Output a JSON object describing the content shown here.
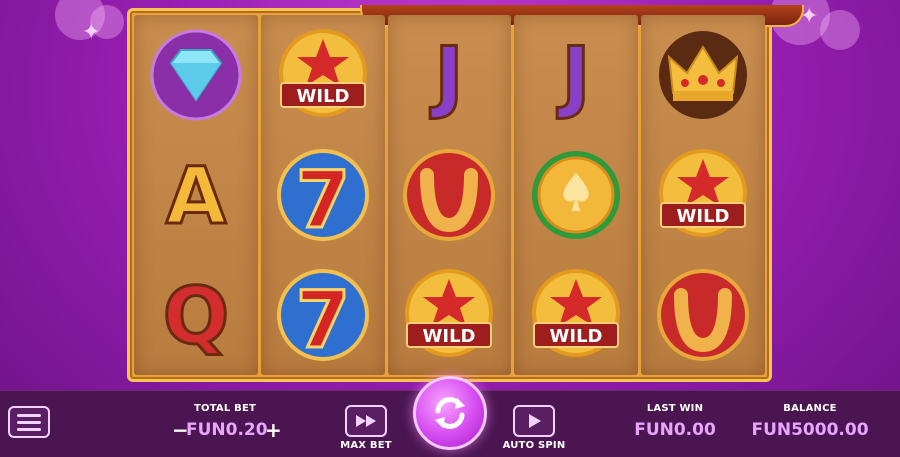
{
  "reels": [
    [
      "diamond",
      "letter-a",
      "letter-q"
    ],
    [
      "wild",
      "seven",
      "seven"
    ],
    [
      "letter-j",
      "horseshoe",
      "wild"
    ],
    [
      "letter-j",
      "spade-coin",
      "wild"
    ],
    [
      "crown",
      "wild",
      "horseshoe"
    ]
  ],
  "wild_label": "WILD",
  "letters": {
    "a": "A",
    "q": "Q",
    "j": "J",
    "seven": "7"
  },
  "bottom_bar": {
    "total_bet_label": "TOTAL BET",
    "total_bet_value": "FUN0.20",
    "minus": "−",
    "plus": "+",
    "max_bet_label": "MAX BET",
    "auto_spin_label": "AUTO SPIN",
    "last_win_label": "LAST WIN",
    "last_win_value": "FUN0.00",
    "balance_label": "BALANCE",
    "balance_value": "FUN5000.00"
  },
  "colors": {
    "accent": "#e9a4ff",
    "bar": "#4a1550",
    "reel_frame": "#e9a23b"
  }
}
